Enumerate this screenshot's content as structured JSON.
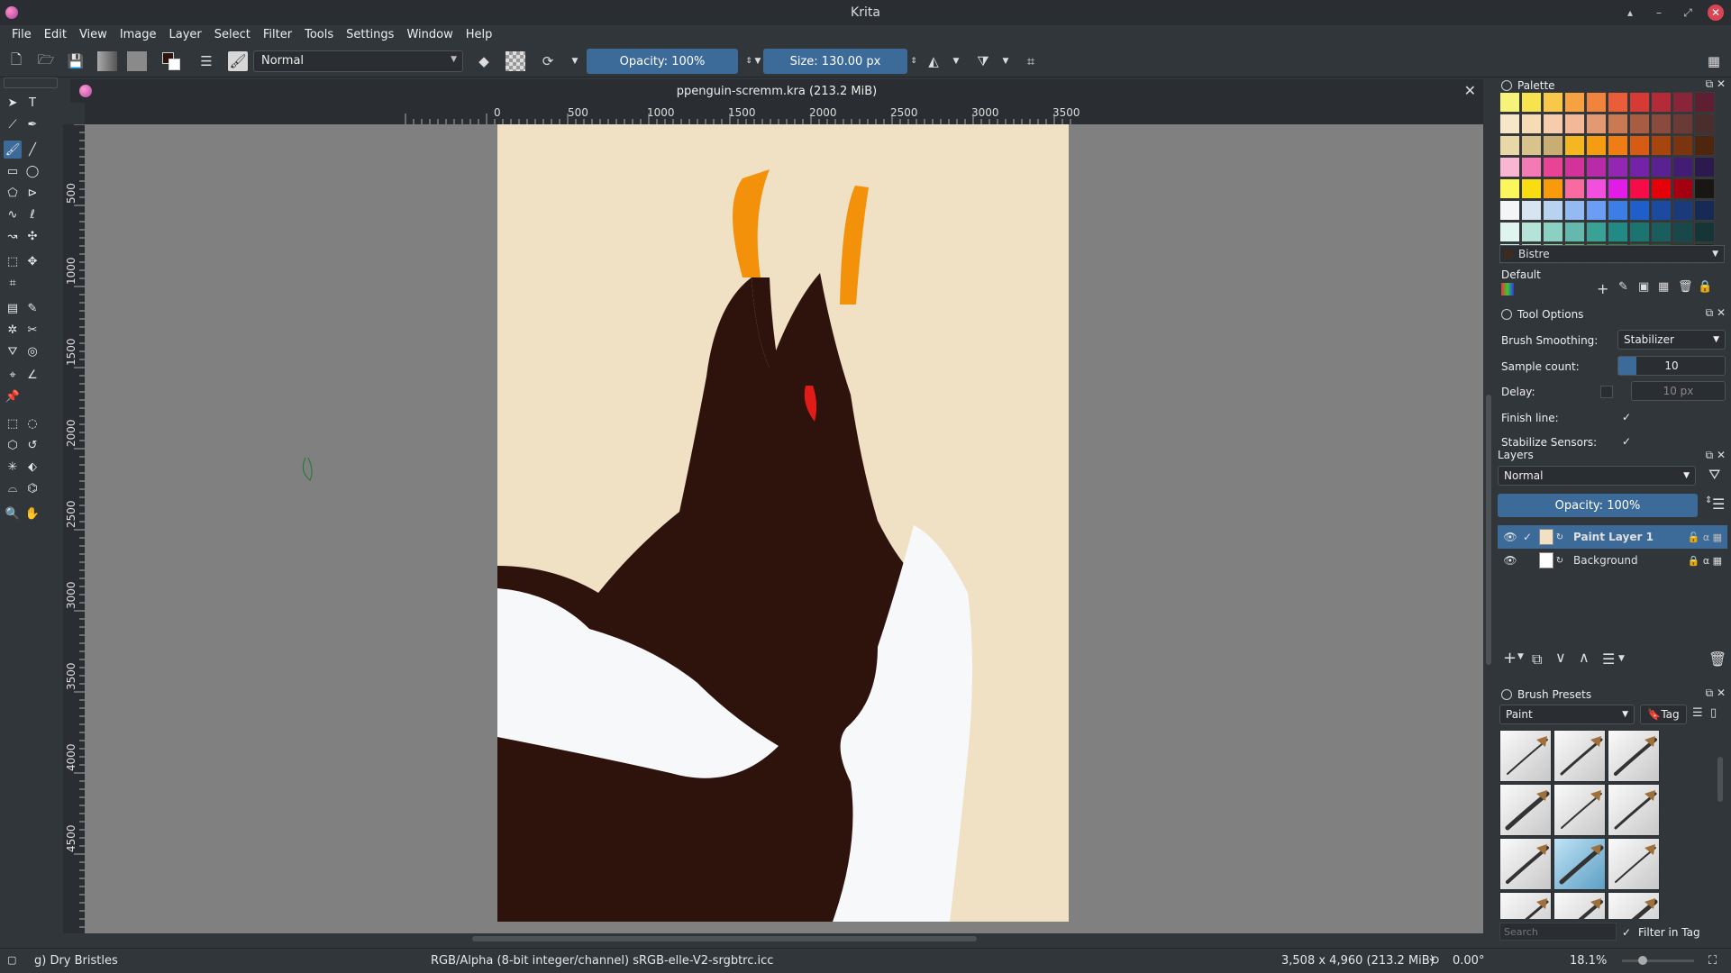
{
  "window": {
    "title": "Krita"
  },
  "menu": [
    "File",
    "Edit",
    "View",
    "Image",
    "Layer",
    "Select",
    "Filter",
    "Tools",
    "Settings",
    "Window",
    "Help"
  ],
  "toolbar": {
    "blend_mode": "Normal",
    "opacity": "Opacity: 100%",
    "size": "Size: 130.00 px"
  },
  "document": {
    "tab_title": "ppenguin-scremm.kra (213.2 MiB)",
    "ruler_h": [
      "0",
      "500",
      "1000",
      "1500",
      "2000",
      "2500",
      "3000",
      "3500"
    ],
    "ruler_v": [
      "500",
      "1000",
      "1500",
      "2000",
      "2500",
      "3000",
      "3500",
      "4000",
      "4500"
    ]
  },
  "palette": {
    "title": "Palette",
    "selected_color_name": "Bistre",
    "palette_name": "Default",
    "rows": [
      [
        "#f6f27a",
        "#f7e34f",
        "#f8c84a",
        "#f6a243",
        "#f0843d",
        "#e95e38",
        "#d63a35",
        "#b32a39",
        "#8a2439",
        "#5e1f32"
      ],
      [
        "#f5e7c8",
        "#f6dcb5",
        "#f5ccac",
        "#f2b898",
        "#e39a72",
        "#c97a52",
        "#a85c42",
        "#8a4a3e",
        "#6a3a36",
        "#4a2d2d"
      ],
      [
        "#e8d8a8",
        "#d9c38c",
        "#c9ae74",
        "#f4b722",
        "#f59c12",
        "#ef7d13",
        "#d75b12",
        "#a8450f",
        "#7a340f",
        "#4e260e"
      ],
      [
        "#f8b6d2",
        "#f37ab4",
        "#e94395",
        "#d3329a",
        "#b82aa8",
        "#9326b3",
        "#7423a8",
        "#5a2192",
        "#431d73",
        "#2c1a4f"
      ],
      [
        "#fbf65b",
        "#fadc12",
        "#f99a0c",
        "#f86ba0",
        "#f34fdf",
        "#e21ce7",
        "#f70c4a",
        "#e60009",
        "#a50011",
        "#1a1614"
      ],
      [
        "#f4f5f6",
        "#d7e4f2",
        "#b8d3f0",
        "#93baf2",
        "#6a9ef4",
        "#3b7ee6",
        "#1f5fc9",
        "#1c4aa0",
        "#1a3a7a",
        "#172a55"
      ],
      [
        "#dff3ef",
        "#b6e3d9",
        "#8ccfc3",
        "#64b8ad",
        "#3aa197",
        "#218a84",
        "#1c7470",
        "#1a5d5c",
        "#184849",
        "#153536"
      ],
      [
        "#c7f0ef",
        "#a8e3c7",
        "#88d4a1",
        "#5dbf73",
        "#2fa653",
        "#208e47",
        "#1b763d",
        "#165e33",
        "#124829",
        "#0e321f"
      ]
    ]
  },
  "tool_options": {
    "title": "Tool Options",
    "brush_smoothing_label": "Brush Smoothing:",
    "brush_smoothing_value": "Stabilizer",
    "sample_count_label": "Sample count:",
    "sample_count_value": "10",
    "delay_label": "Delay:",
    "delay_value": "10 px",
    "finish_line_label": "Finish line:",
    "stabilize_sensors_label": "Stabilize Sensors:"
  },
  "layers": {
    "title": "Layers",
    "blend_mode": "Normal",
    "opacity": "Opacity: 100%",
    "items": [
      {
        "name": "Paint Layer 1",
        "selected": true
      },
      {
        "name": "Background",
        "selected": false
      }
    ]
  },
  "brush_presets": {
    "title": "Brush Presets",
    "category": "Paint",
    "tag_label": "Tag",
    "search_placeholder": "Search",
    "filter_in_tag": "Filter in Tag"
  },
  "status": {
    "brush_name": "g) Dry Bristles",
    "color_profile": "RGB/Alpha (8-bit integer/channel)  sRGB-elle-V2-srgbtrc.icc",
    "image_size": "3,508 x 4,960 (213.2 MiB)",
    "rotation": "0.00°",
    "zoom": "18.1%"
  },
  "colors": {
    "accent": "#3d6b99",
    "canvas_bg": "#f1e1c4",
    "penguin_body": "#2e130c",
    "beak": "#f3920a",
    "eye": "#e11b17",
    "belly": "#f7f8fa"
  }
}
